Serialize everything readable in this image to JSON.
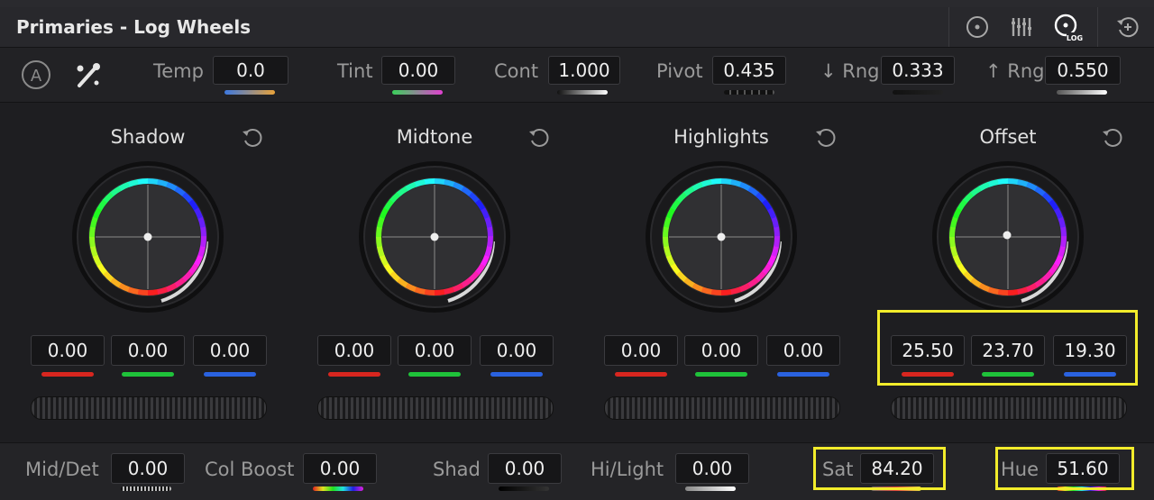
{
  "header": {
    "title": "Primaries - Log Wheels"
  },
  "toolbar": {
    "auto_label": "A",
    "temp": {
      "label": "Temp",
      "value": "0.0"
    },
    "tint": {
      "label": "Tint",
      "value": "0.00"
    },
    "cont": {
      "label": "Cont",
      "value": "1.000"
    },
    "pivot": {
      "label": "Pivot",
      "value": "0.435"
    },
    "low_rng": {
      "label": "↓ Rng",
      "value": "0.333"
    },
    "high_rng": {
      "label": "↑ Rng",
      "value": "0.550"
    }
  },
  "wheels": [
    {
      "title": "Shadow",
      "values": [
        "0.00",
        "0.00",
        "0.00"
      ]
    },
    {
      "title": "Midtone",
      "values": [
        "0.00",
        "0.00",
        "0.00"
      ]
    },
    {
      "title": "Highlights",
      "values": [
        "0.00",
        "0.00",
        "0.00"
      ]
    },
    {
      "title": "Offset",
      "values": [
        "25.50",
        "23.70",
        "19.30"
      ]
    }
  ],
  "bottom": {
    "mid_det": {
      "label": "Mid/Det",
      "value": "0.00"
    },
    "col_boost": {
      "label": "Col Boost",
      "value": "0.00"
    },
    "shad": {
      "label": "Shad",
      "value": "0.00"
    },
    "hi_light": {
      "label": "Hi/Light",
      "value": "0.00"
    },
    "sat": {
      "label": "Sat",
      "value": "84.20"
    },
    "hue": {
      "label": "Hue",
      "value": "51.60"
    }
  },
  "mode_icons": [
    "color-wheels-icon",
    "bars-icon",
    "log-icon",
    "reset-all-icon"
  ],
  "colors": {
    "highlight": "#f2ec2b",
    "red": "#d8261f",
    "green": "#1fc23a",
    "blue": "#2a62e0"
  }
}
